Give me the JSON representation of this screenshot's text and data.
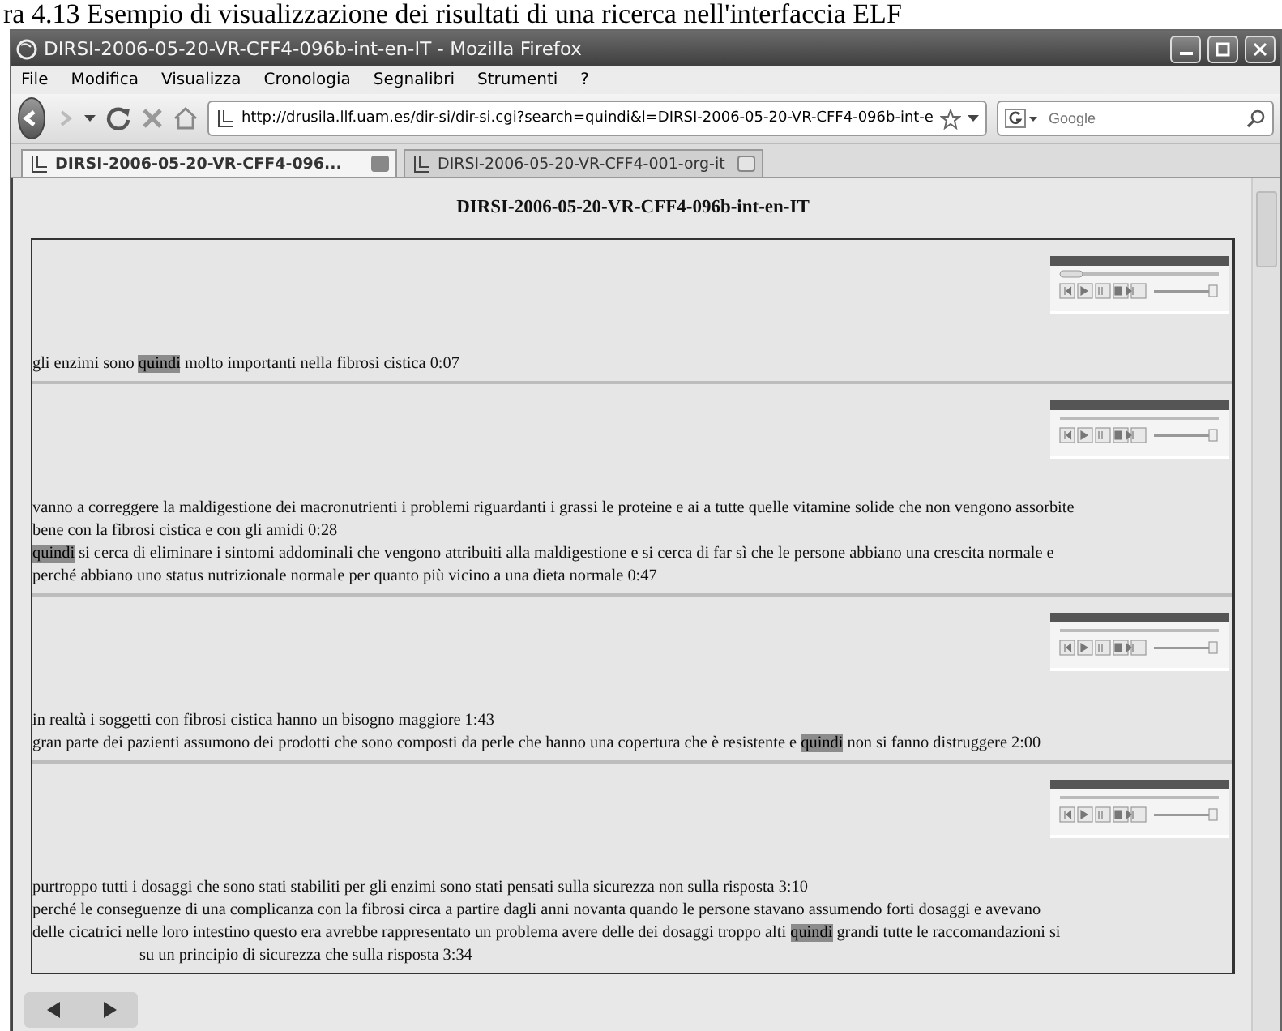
{
  "caption": "ra 4.13 Esempio di visualizzazione dei risultati di una ricerca nell'interfaccia ELF",
  "window": {
    "title": "DIRSI-2006-05-20-VR-CFF4-096b-int-en-IT - Mozilla Firefox"
  },
  "menu": [
    "File",
    "Modifica",
    "Visualizza",
    "Cronologia",
    "Segnalibri",
    "Strumenti",
    "?"
  ],
  "address": {
    "value": "http://drusila.llf.uam.es/dir-si/dir-si.cgi?search=quindi&l=DIRSI-2006-05-20-VR-CFF4-096b-int-e"
  },
  "search": {
    "placeholder": "Google"
  },
  "tabs": [
    {
      "label": "DIRSI-2006-05-20-VR-CFF4-096...",
      "selected": true
    },
    {
      "label": "DIRSI-2006-05-20-VR-CFF4-001-org-it",
      "selected": false
    }
  ],
  "page": {
    "heading": "DIRSI-2006-05-20-VR-CFF4-096b-int-en-IT",
    "results": [
      {
        "lines": [
          [
            {
              "text": "gli enzimi sono ",
              "highlight": false
            },
            {
              "text": "quindi",
              "highlight": true
            },
            {
              "text": " molto importanti nella fibrosi cistica 0:07",
              "highlight": false
            }
          ]
        ]
      },
      {
        "lines": [
          [
            {
              "text": "vanno a correggere la maldigestione dei macronutrienti i problemi riguardanti i grassi le proteine e ai a tutte quelle vitamine solide che non vengono assorbite",
              "highlight": false
            }
          ],
          [
            {
              "text": "bene con la fibrosi cistica e con gli amidi 0:28",
              "highlight": false
            }
          ],
          [
            {
              "text": "quindi",
              "highlight": true
            },
            {
              "text": " si cerca di eliminare i sintomi addominali che vengono attribuiti alla maldigestione e si cerca di far sì che le persone abbiano una crescita normale e",
              "highlight": false
            }
          ],
          [
            {
              "text": "perché abbiano uno status nutrizionale normale per quanto più vicino a una dieta normale 0:47",
              "highlight": false
            }
          ]
        ]
      },
      {
        "lines": [
          [
            {
              "text": "in realtà i soggetti con fibrosi cistica hanno un bisogno maggiore 1:43",
              "highlight": false
            }
          ],
          [
            {
              "text": "gran parte dei pazienti assumono dei prodotti che sono composti da perle che hanno una copertura che è resistente e ",
              "highlight": false
            },
            {
              "text": "quindi",
              "highlight": true
            },
            {
              "text": " non si fanno distruggere 2:00",
              "highlight": false
            }
          ]
        ]
      },
      {
        "lines": [
          [
            {
              "text": "purtroppo tutti i dosaggi che sono stati stabiliti per gli enzimi sono stati pensati sulla sicurezza non sulla risposta 3:10",
              "highlight": false
            }
          ],
          [
            {
              "text": "perché le conseguenze di una complicanza con la fibrosi circa a partire dagli anni novanta quando le persone stavano assumendo forti dosaggi e avevano",
              "highlight": false
            }
          ],
          [
            {
              "text": "delle cicatrici nelle loro intestino questo era avrebbe rappresentato un problema avere delle dei dosaggi troppo alti ",
              "highlight": false
            },
            {
              "text": "quindi",
              "highlight": true
            },
            {
              "text": " grandi tutte le raccomandazioni si",
              "highlight": false
            }
          ],
          [
            {
              "text": "su un principio di sicurezza che sulla risposta 3:34",
              "highlight": false
            }
          ]
        ]
      }
    ]
  }
}
